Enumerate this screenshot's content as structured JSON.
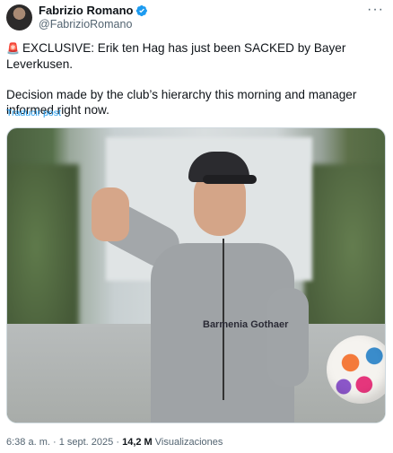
{
  "author": {
    "display_name": "Fabrizio Romano",
    "handle": "@FabrizioRomano",
    "verified": true
  },
  "menu": {
    "more_label": "···"
  },
  "tweet": {
    "emoji": "🚨",
    "line1": "EXCLUSIVE: Erik ten Hag has just been SACKED by Bayer Leverkusen.",
    "line2": "Decision made by the club’s hierarchy this morning and manager informed right now.",
    "translate_label": "Traducir post"
  },
  "media": {
    "jersey_text": "Barmenia Gothaer"
  },
  "meta": {
    "time": "6:38 a. m.",
    "separator": "·",
    "date": "1 sept. 2025",
    "views_count": "14,2 M",
    "views_label": "Visualizaciones"
  },
  "colors": {
    "link": "#1d9bf0",
    "muted": "#536471",
    "verified_badge": "#1d9bf0"
  }
}
